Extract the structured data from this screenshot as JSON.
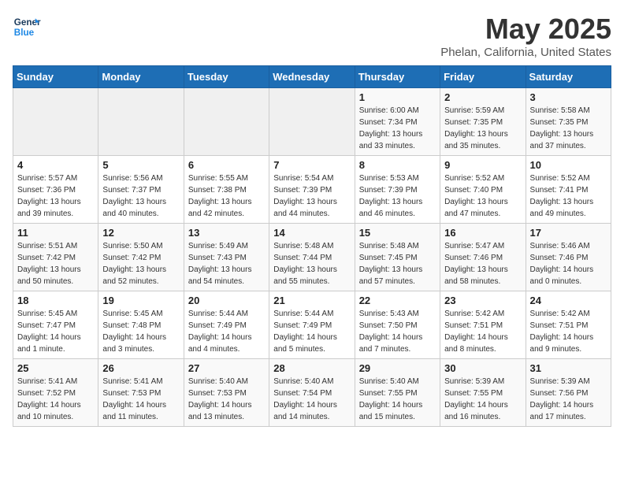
{
  "header": {
    "logo_line1": "General",
    "logo_line2": "Blue",
    "month": "May 2025",
    "location": "Phelan, California, United States"
  },
  "weekdays": [
    "Sunday",
    "Monday",
    "Tuesday",
    "Wednesday",
    "Thursday",
    "Friday",
    "Saturday"
  ],
  "weeks": [
    [
      {
        "day": "",
        "info": ""
      },
      {
        "day": "",
        "info": ""
      },
      {
        "day": "",
        "info": ""
      },
      {
        "day": "",
        "info": ""
      },
      {
        "day": "1",
        "info": "Sunrise: 6:00 AM\nSunset: 7:34 PM\nDaylight: 13 hours\nand 33 minutes."
      },
      {
        "day": "2",
        "info": "Sunrise: 5:59 AM\nSunset: 7:35 PM\nDaylight: 13 hours\nand 35 minutes."
      },
      {
        "day": "3",
        "info": "Sunrise: 5:58 AM\nSunset: 7:35 PM\nDaylight: 13 hours\nand 37 minutes."
      }
    ],
    [
      {
        "day": "4",
        "info": "Sunrise: 5:57 AM\nSunset: 7:36 PM\nDaylight: 13 hours\nand 39 minutes."
      },
      {
        "day": "5",
        "info": "Sunrise: 5:56 AM\nSunset: 7:37 PM\nDaylight: 13 hours\nand 40 minutes."
      },
      {
        "day": "6",
        "info": "Sunrise: 5:55 AM\nSunset: 7:38 PM\nDaylight: 13 hours\nand 42 minutes."
      },
      {
        "day": "7",
        "info": "Sunrise: 5:54 AM\nSunset: 7:39 PM\nDaylight: 13 hours\nand 44 minutes."
      },
      {
        "day": "8",
        "info": "Sunrise: 5:53 AM\nSunset: 7:39 PM\nDaylight: 13 hours\nand 46 minutes."
      },
      {
        "day": "9",
        "info": "Sunrise: 5:52 AM\nSunset: 7:40 PM\nDaylight: 13 hours\nand 47 minutes."
      },
      {
        "day": "10",
        "info": "Sunrise: 5:52 AM\nSunset: 7:41 PM\nDaylight: 13 hours\nand 49 minutes."
      }
    ],
    [
      {
        "day": "11",
        "info": "Sunrise: 5:51 AM\nSunset: 7:42 PM\nDaylight: 13 hours\nand 50 minutes."
      },
      {
        "day": "12",
        "info": "Sunrise: 5:50 AM\nSunset: 7:42 PM\nDaylight: 13 hours\nand 52 minutes."
      },
      {
        "day": "13",
        "info": "Sunrise: 5:49 AM\nSunset: 7:43 PM\nDaylight: 13 hours\nand 54 minutes."
      },
      {
        "day": "14",
        "info": "Sunrise: 5:48 AM\nSunset: 7:44 PM\nDaylight: 13 hours\nand 55 minutes."
      },
      {
        "day": "15",
        "info": "Sunrise: 5:48 AM\nSunset: 7:45 PM\nDaylight: 13 hours\nand 57 minutes."
      },
      {
        "day": "16",
        "info": "Sunrise: 5:47 AM\nSunset: 7:46 PM\nDaylight: 13 hours\nand 58 minutes."
      },
      {
        "day": "17",
        "info": "Sunrise: 5:46 AM\nSunset: 7:46 PM\nDaylight: 14 hours\nand 0 minutes."
      }
    ],
    [
      {
        "day": "18",
        "info": "Sunrise: 5:45 AM\nSunset: 7:47 PM\nDaylight: 14 hours\nand 1 minute."
      },
      {
        "day": "19",
        "info": "Sunrise: 5:45 AM\nSunset: 7:48 PM\nDaylight: 14 hours\nand 3 minutes."
      },
      {
        "day": "20",
        "info": "Sunrise: 5:44 AM\nSunset: 7:49 PM\nDaylight: 14 hours\nand 4 minutes."
      },
      {
        "day": "21",
        "info": "Sunrise: 5:44 AM\nSunset: 7:49 PM\nDaylight: 14 hours\nand 5 minutes."
      },
      {
        "day": "22",
        "info": "Sunrise: 5:43 AM\nSunset: 7:50 PM\nDaylight: 14 hours\nand 7 minutes."
      },
      {
        "day": "23",
        "info": "Sunrise: 5:42 AM\nSunset: 7:51 PM\nDaylight: 14 hours\nand 8 minutes."
      },
      {
        "day": "24",
        "info": "Sunrise: 5:42 AM\nSunset: 7:51 PM\nDaylight: 14 hours\nand 9 minutes."
      }
    ],
    [
      {
        "day": "25",
        "info": "Sunrise: 5:41 AM\nSunset: 7:52 PM\nDaylight: 14 hours\nand 10 minutes."
      },
      {
        "day": "26",
        "info": "Sunrise: 5:41 AM\nSunset: 7:53 PM\nDaylight: 14 hours\nand 11 minutes."
      },
      {
        "day": "27",
        "info": "Sunrise: 5:40 AM\nSunset: 7:53 PM\nDaylight: 14 hours\nand 13 minutes."
      },
      {
        "day": "28",
        "info": "Sunrise: 5:40 AM\nSunset: 7:54 PM\nDaylight: 14 hours\nand 14 minutes."
      },
      {
        "day": "29",
        "info": "Sunrise: 5:40 AM\nSunset: 7:55 PM\nDaylight: 14 hours\nand 15 minutes."
      },
      {
        "day": "30",
        "info": "Sunrise: 5:39 AM\nSunset: 7:55 PM\nDaylight: 14 hours\nand 16 minutes."
      },
      {
        "day": "31",
        "info": "Sunrise: 5:39 AM\nSunset: 7:56 PM\nDaylight: 14 hours\nand 17 minutes."
      }
    ]
  ]
}
